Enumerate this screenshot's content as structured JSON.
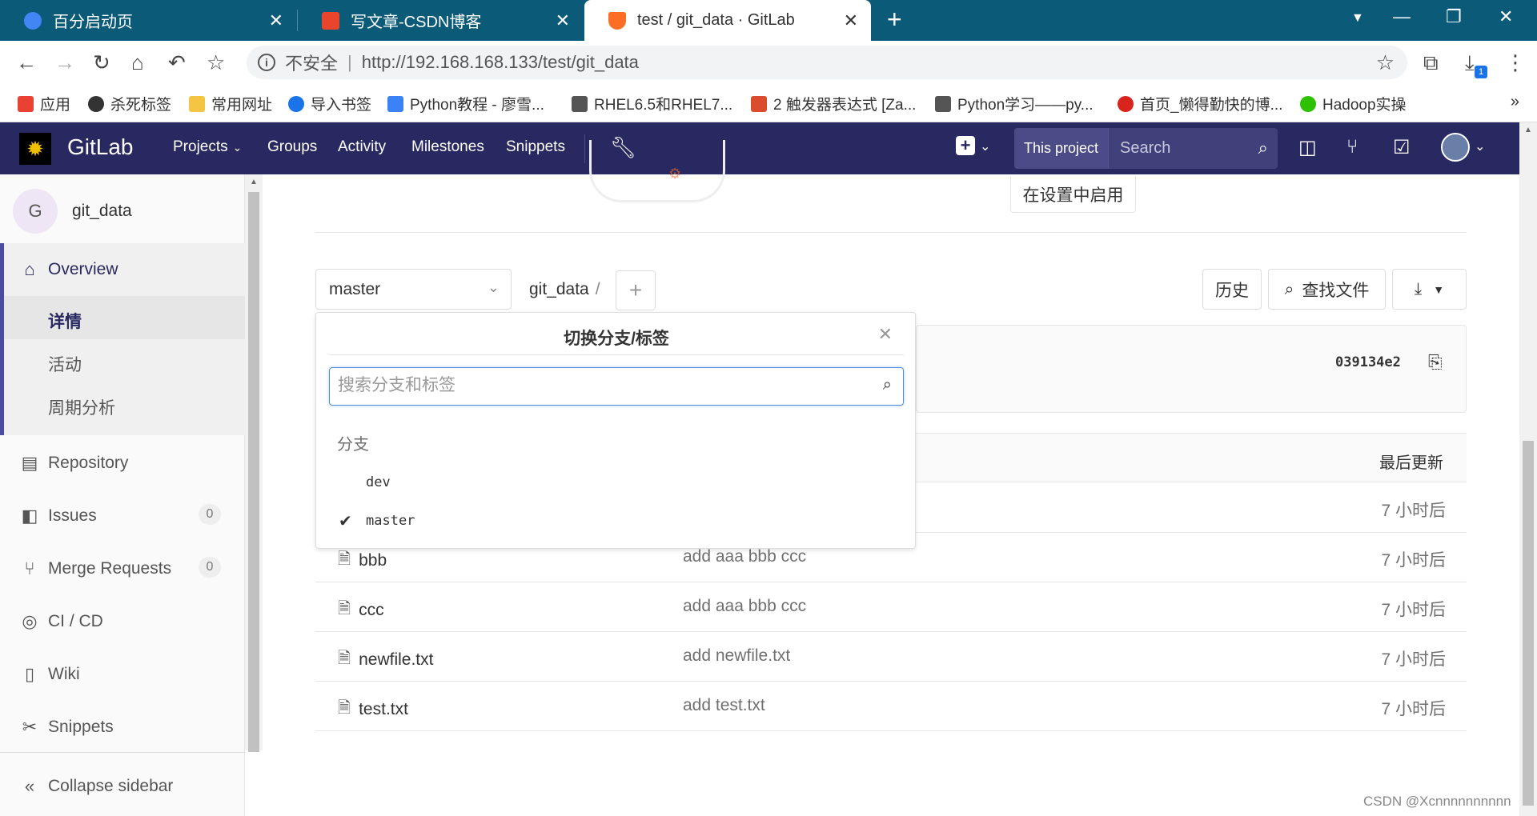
{
  "browser": {
    "tabs": [
      {
        "title": "百分启动页",
        "color": "#4285f4"
      },
      {
        "title": "写文章-CSDN博客",
        "color": "#e8452c"
      },
      {
        "title": "test / git_data · GitLab",
        "color": "#fc6d26"
      }
    ],
    "new_tab": "+",
    "insecure_label": "不安全",
    "url": "http://192.168.168.133/test/git_data",
    "download_badge": "1",
    "bookmarks": [
      {
        "label": "应用",
        "color": "#e94235"
      },
      {
        "label": "杀死标签",
        "color": "#333333"
      },
      {
        "label": "常用网址",
        "color": "#f4c542"
      },
      {
        "label": "导入书签",
        "color": "#1a73e8"
      },
      {
        "label": "Python教程 - 廖雪...",
        "color": "#3b82f6"
      },
      {
        "label": "RHEL6.5和RHEL7...",
        "color": "#555555"
      },
      {
        "label": "2 触发器表达式 [Za...",
        "color": "#d94c2e"
      },
      {
        "label": "Python学习——py...",
        "color": "#555555"
      },
      {
        "label": "首页_懒得勤快的博...",
        "color": "#d9231d"
      },
      {
        "label": "Hadoop实操",
        "color": "#2dc100"
      }
    ],
    "bookmarks_more": "»"
  },
  "gitlab": {
    "brand": "GitLab",
    "nav": {
      "projects": "Projects",
      "groups": "Groups",
      "activity": "Activity",
      "milestones": "Milestones",
      "snippets": "Snippets"
    },
    "search_scope": "This project",
    "search_placeholder": "Search",
    "header_color": "#292961"
  },
  "sidebar": {
    "project_initial": "G",
    "project_name": "git_data",
    "overview": "Overview",
    "sub": {
      "details": "详情",
      "activity": "活动",
      "cycle": "周期分析"
    },
    "repository": "Repository",
    "issues": "Issues",
    "issues_count": "0",
    "merge_requests": "Merge Requests",
    "mr_count": "0",
    "cicd": "CI / CD",
    "wiki": "Wiki",
    "snippets": "Snippets",
    "collapse": "Collapse sidebar"
  },
  "main": {
    "enable_in_settings": "在设置中启用",
    "branch": "master",
    "breadcrumb": "git_data",
    "breadcrumb_sep": "/",
    "add_button": "+",
    "history": "历史",
    "find_file": "查找文件",
    "commit_sha": "039134e2",
    "last_update_header": "最后更新",
    "first_row_time": "7 小时后",
    "files": [
      {
        "name": "bbb",
        "message": "add aaa bbb ccc",
        "time": "7 小时后"
      },
      {
        "name": "ccc",
        "message": "add aaa bbb ccc",
        "time": "7 小时后"
      },
      {
        "name": "newfile.txt",
        "message": "add newfile.txt",
        "time": "7 小时后"
      },
      {
        "name": "test.txt",
        "message": "add test.txt",
        "time": "7 小时后"
      }
    ]
  },
  "dropdown": {
    "title": "切换分支/标签",
    "search_placeholder": "搜索分支和标签",
    "section": "分支",
    "branches": [
      {
        "name": "dev",
        "selected": false
      },
      {
        "name": "master",
        "selected": true
      }
    ]
  },
  "watermark": "CSDN @Xcnnnnnnnnnn"
}
